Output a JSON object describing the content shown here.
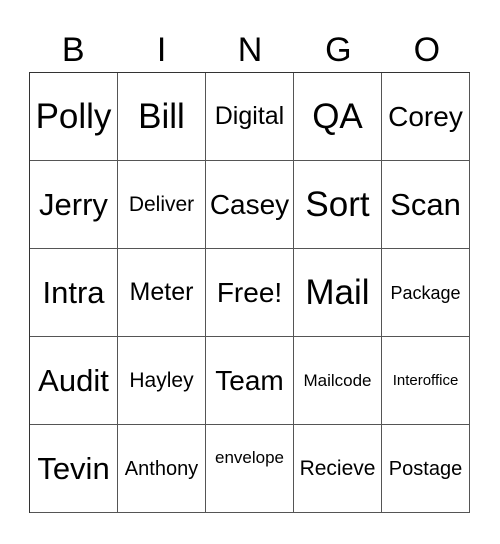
{
  "header": {
    "letters": [
      "B",
      "I",
      "N",
      "G",
      "O"
    ]
  },
  "cells": [
    [
      "Polly",
      "Bill",
      "Digital",
      "QA",
      "Corey"
    ],
    [
      "Jerry",
      "Deliver",
      "Casey",
      "Sort",
      "Scan"
    ],
    [
      "Intra",
      "Meter",
      "Free!",
      "Mail",
      "Package"
    ],
    [
      "Audit",
      "Hayley",
      "Team",
      "Mailcode",
      "Interoffice"
    ],
    [
      "Tevin",
      "Anthony",
      "envelope",
      "Recieve",
      "Postage"
    ]
  ]
}
